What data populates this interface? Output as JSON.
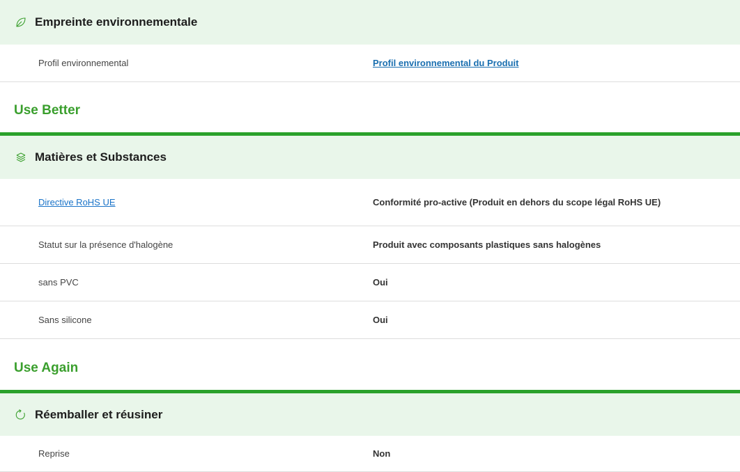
{
  "sections": {
    "env_footprint": {
      "title": "Empreinte environnementale",
      "icon": "leaf-icon"
    },
    "materials": {
      "title": "Matières et Substances",
      "icon": "layers-icon"
    },
    "repack": {
      "title": "Réemballer et réusiner",
      "icon": "refresh-icon"
    }
  },
  "groups": {
    "use_better": "Use Better",
    "use_again": "Use Again"
  },
  "rows": {
    "env_profile": {
      "label": "Profil environnemental",
      "value": "Profil environnemental du Produit"
    },
    "rohs": {
      "label": "Directive RoHS UE",
      "value": "Conformité pro-active (Produit en dehors du scope légal RoHS UE)"
    },
    "halogen": {
      "label": "Statut sur la présence d'halogène",
      "value": "Produit avec composants plastiques sans halogènes"
    },
    "pvc": {
      "label": "sans PVC",
      "value": "Oui"
    },
    "silicone": {
      "label": "Sans silicone",
      "value": "Oui"
    },
    "takeback": {
      "label": "Reprise",
      "value": "Non"
    }
  },
  "colors": {
    "section_bg": "#e9f6ea",
    "accent_green": "#2aa12b",
    "group_title": "#3a9f2d",
    "link": "#1a73c8"
  }
}
